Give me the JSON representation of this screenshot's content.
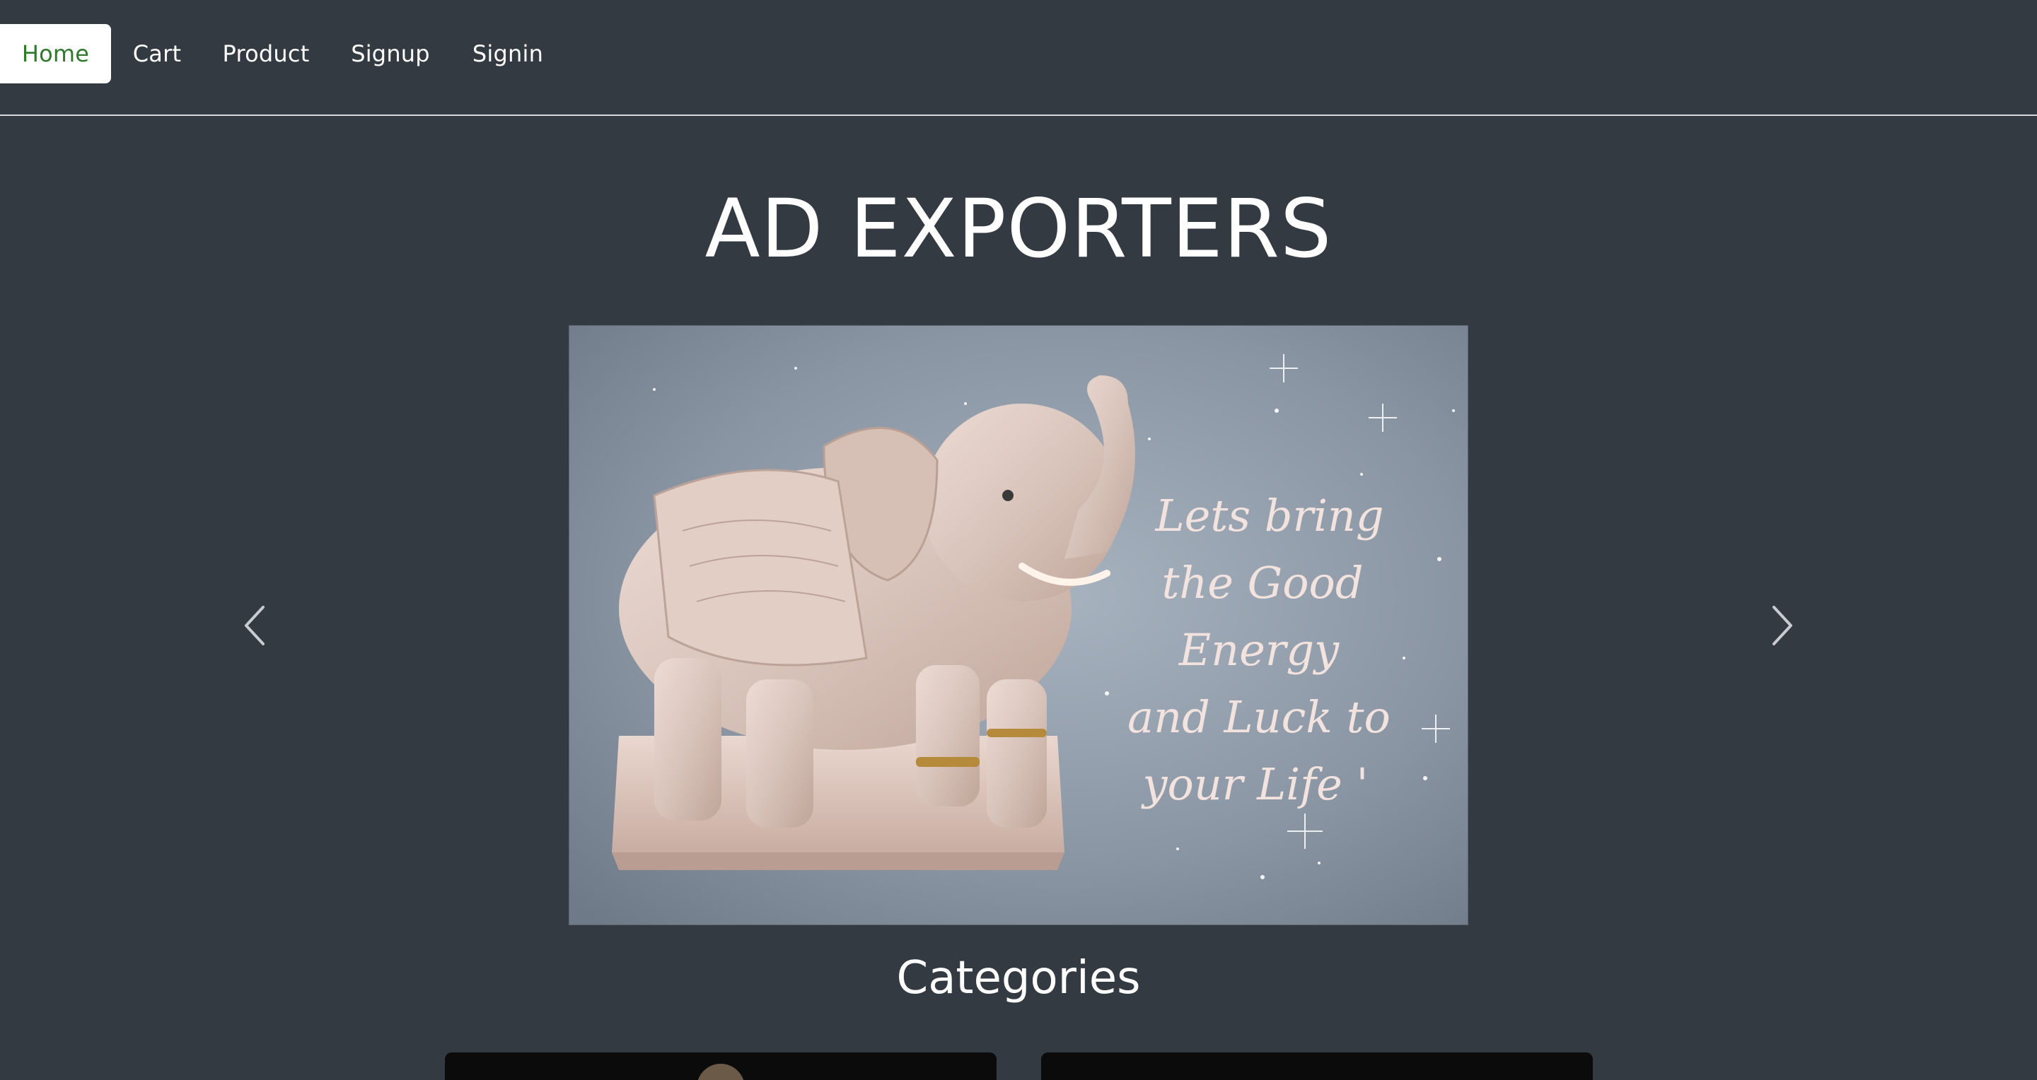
{
  "nav": {
    "items": [
      {
        "label": "Home",
        "active": true
      },
      {
        "label": "Cart",
        "active": false
      },
      {
        "label": "Product",
        "active": false
      },
      {
        "label": "Signup",
        "active": false
      },
      {
        "label": "Signin",
        "active": false
      }
    ]
  },
  "hero": {
    "title": "AD EXPORTERS"
  },
  "carousel": {
    "slides": [
      {
        "image_description_icon": "marble-elephant-image",
        "overlay_text_lines": [
          "Lets bring",
          "the Good",
          "Energy",
          "and Luck to",
          "your Life '"
        ]
      }
    ],
    "prev_icon": "chevron-left-icon",
    "next_icon": "chevron-right-icon"
  },
  "categories": {
    "title": "Categories"
  },
  "colors": {
    "background": "#343a42",
    "nav_active_bg": "#ffffff",
    "nav_active_text": "#2f7a2a",
    "text": "#ffffff"
  }
}
